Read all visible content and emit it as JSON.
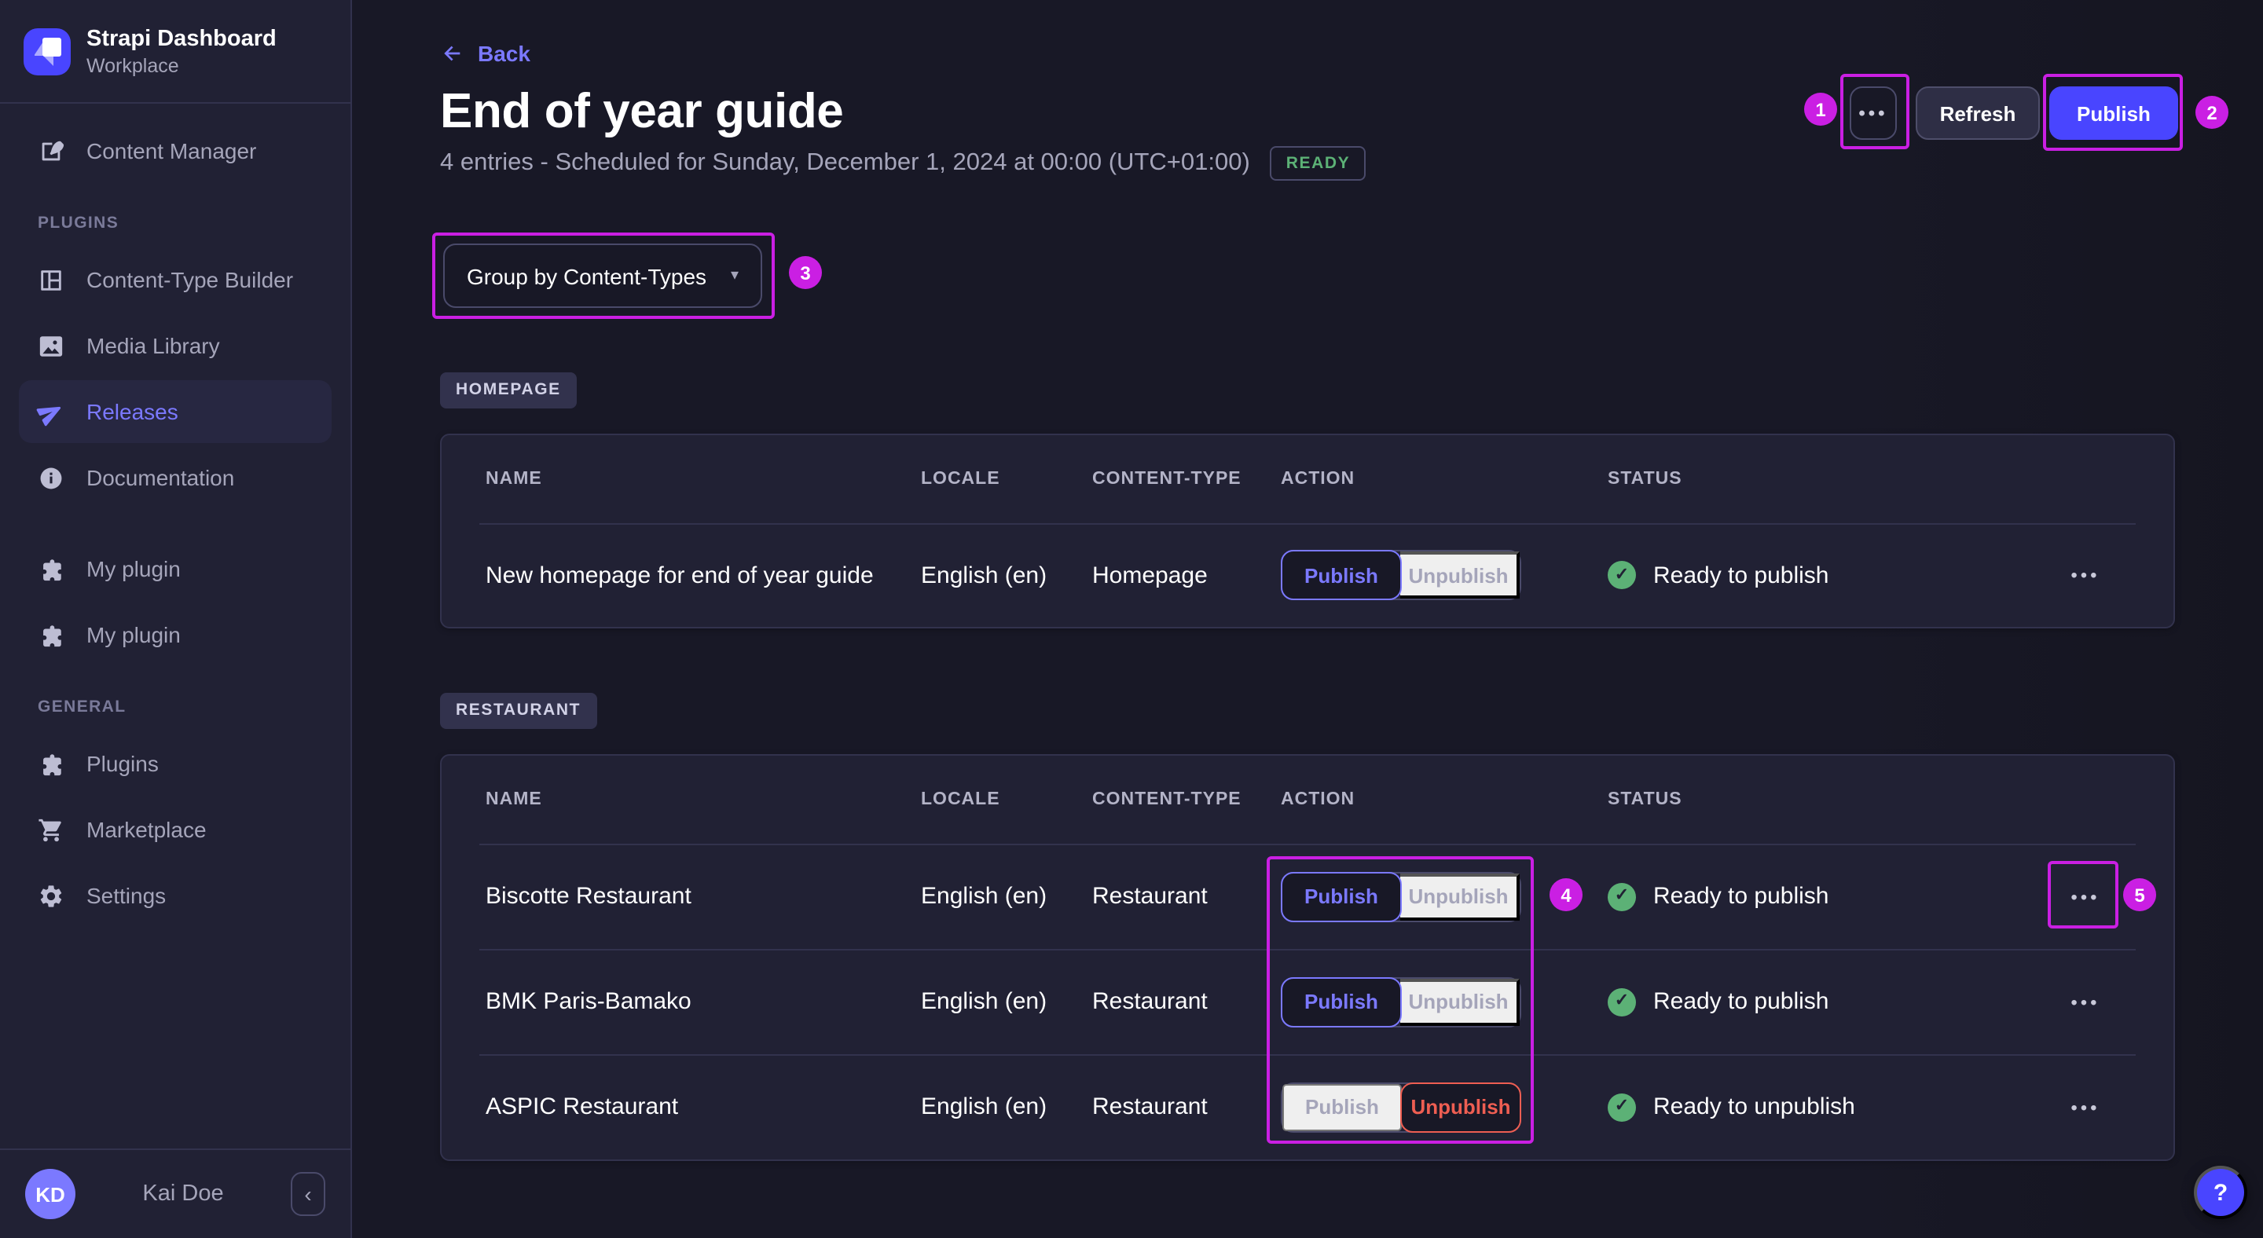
{
  "colors": {
    "page_bg": "#181826",
    "panel_bg": "#212134",
    "border": "#32324d",
    "accent": "#4945ff",
    "accent_light": "#7b79ff",
    "success": "#5cb176",
    "danger": "#ee5e52",
    "annotation": "#ca1fe3",
    "text_muted": "#a5a5ba"
  },
  "sidebar": {
    "app_title": "Strapi Dashboard",
    "workspace": "Workplace",
    "content_manager": "Content Manager",
    "sections": [
      {
        "label": "PLUGINS",
        "items": [
          "Content-Type Builder",
          "Media Library",
          "Releases",
          "Documentation",
          "My plugin",
          "My plugin"
        ]
      },
      {
        "label": "GENERAL",
        "items": [
          "Plugins",
          "Marketplace",
          "Settings"
        ]
      }
    ],
    "user_initials": "KD",
    "user_name": "Kai Doe"
  },
  "header": {
    "back_label": "Back",
    "title": "End of year guide",
    "subtitle": "4 entries - Scheduled for Sunday, December 1, 2024 at 00:00 (UTC+01:00)",
    "status_badge": "READY",
    "refresh_label": "Refresh",
    "publish_label": "Publish"
  },
  "toolbar": {
    "group_by": "Group by Content-Types"
  },
  "columns": {
    "name": "NAME",
    "locale": "LOCALE",
    "content_type": "CONTENT-TYPE",
    "action": "ACTION",
    "status": "STATUS"
  },
  "actions": {
    "publish": "Publish",
    "unpublish": "Unpublish"
  },
  "groups": [
    {
      "tag": "HOMEPAGE",
      "rows": [
        {
          "name": "New homepage for end of year guide",
          "locale": "English (en)",
          "content_type": "Homepage",
          "status": "Ready to publish",
          "selected_action": "publish"
        }
      ]
    },
    {
      "tag": "RESTAURANT",
      "rows": [
        {
          "name": "Biscotte Restaurant",
          "locale": "English (en)",
          "content_type": "Restaurant",
          "status": "Ready to publish",
          "selected_action": "publish"
        },
        {
          "name": "BMK Paris-Bamako",
          "locale": "English (en)",
          "content_type": "Restaurant",
          "status": "Ready to publish",
          "selected_action": "publish"
        },
        {
          "name": "ASPIC Restaurant",
          "locale": "English (en)",
          "content_type": "Restaurant",
          "status": "Ready to unpublish",
          "selected_action": "unpublish"
        }
      ]
    }
  ],
  "annotations": {
    "n1": "1",
    "n2": "2",
    "n3": "3",
    "n4": "4",
    "n5": "5"
  },
  "icons": {
    "more": "•••",
    "caret": "▾",
    "check": "✓",
    "collapse": "‹",
    "help": "?"
  }
}
